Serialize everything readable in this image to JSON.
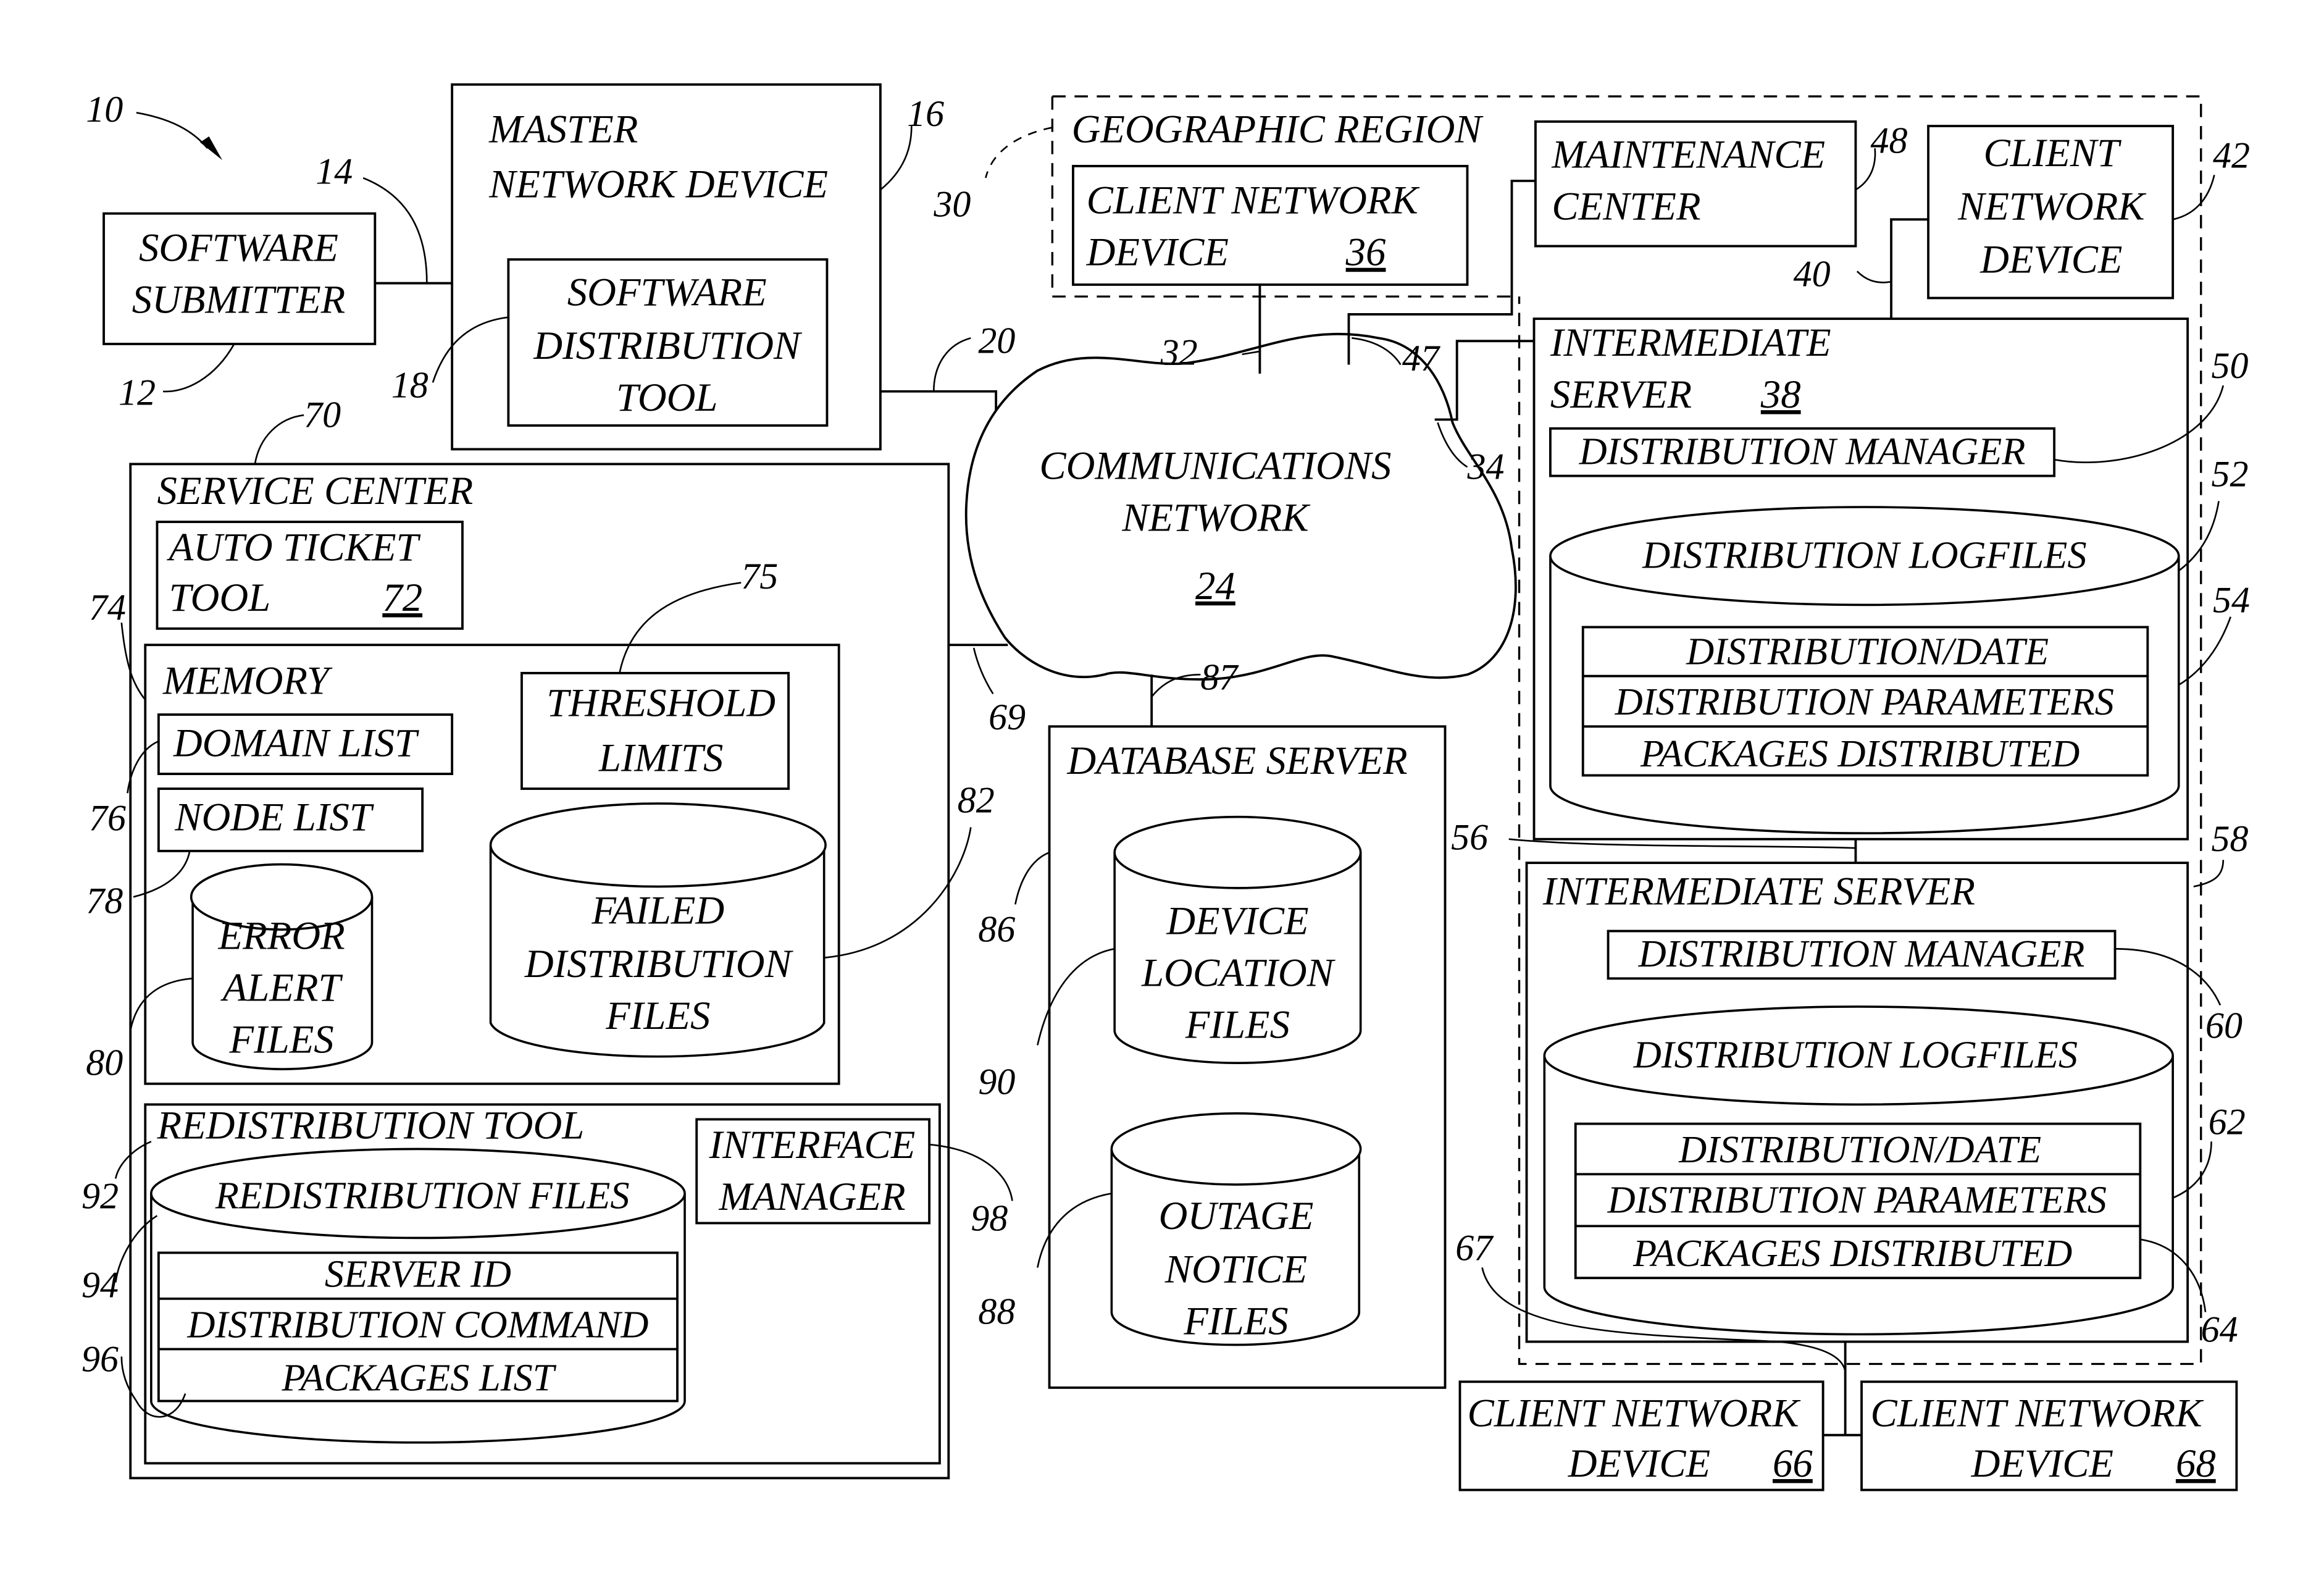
{
  "figure_ref": "10",
  "nodes": {
    "software_submitter": {
      "lines": [
        "SOFTWARE",
        "SUBMITTER"
      ],
      "ref": "12"
    },
    "link_14": {
      "ref": "14"
    },
    "master_network_device": {
      "lines": [
        "MASTER",
        "NETWORK DEVICE"
      ],
      "ref": "16"
    },
    "software_distribution_tool": {
      "lines": [
        "SOFTWARE",
        "DISTRIBUTION",
        "TOOL"
      ],
      "ref": "18"
    },
    "link_20": {
      "ref": "20"
    },
    "communications_network": {
      "lines": [
        "COMMUNICATIONS",
        "NETWORK"
      ],
      "ref": "24"
    },
    "geographic_region": {
      "label": "GEOGRAPHIC REGION",
      "ref": "30"
    },
    "client_device_36": {
      "lines": [
        "CLIENT NETWORK",
        "DEVICE"
      ],
      "ref": "36"
    },
    "link_32": {
      "ref": "32"
    },
    "link_34": {
      "ref": "34"
    },
    "link_47": {
      "ref": "47"
    },
    "maintenance_center": {
      "lines": [
        "MAINTENANCE",
        "CENTER"
      ],
      "ref": "48"
    },
    "client_device_42": {
      "lines": [
        "CLIENT",
        "NETWORK",
        "DEVICE"
      ],
      "ref": "42"
    },
    "link_40": {
      "ref": "40"
    },
    "intermediate_server_38": {
      "lines": [
        "INTERMEDIATE",
        "SERVER"
      ],
      "ref": "38"
    },
    "distribution_manager_50": {
      "label": "DISTRIBUTION MANAGER",
      "ref": "50"
    },
    "distribution_logfiles_52": {
      "label": "DISTRIBUTION LOGFILES",
      "ref": "52",
      "fields": [
        "DISTRIBUTION/DATE",
        "DISTRIBUTION PARAMETERS",
        "PACKAGES DISTRIBUTED"
      ],
      "fields_ref": "54"
    },
    "link_56": {
      "ref": "56"
    },
    "region_58": {
      "ref": "58"
    },
    "intermediate_server_2": {
      "label": "INTERMEDIATE SERVER"
    },
    "distribution_manager_60": {
      "label": "DISTRIBUTION MANAGER",
      "ref": "60"
    },
    "distribution_logfiles_62": {
      "label": "DISTRIBUTION LOGFILES",
      "ref": "62",
      "fields": [
        "DISTRIBUTION/DATE",
        "DISTRIBUTION PARAMETERS",
        "PACKAGES DISTRIBUTED"
      ],
      "fields_ref": "64"
    },
    "link_67": {
      "ref": "67"
    },
    "client_device_66": {
      "lines": [
        "CLIENT NETWORK",
        "DEVICE"
      ],
      "ref": "66"
    },
    "client_device_68": {
      "lines": [
        "CLIENT NETWORK",
        "DEVICE"
      ],
      "ref": "68"
    },
    "service_center": {
      "label": "SERVICE  CENTER",
      "ref": "70"
    },
    "link_69": {
      "ref": "69"
    },
    "auto_ticket_tool": {
      "lines": [
        "AUTO TICKET",
        "TOOL"
      ],
      "ref": "72"
    },
    "memory": {
      "label": "MEMORY",
      "ref": "74"
    },
    "threshold_limits": {
      "lines": [
        "THRESHOLD",
        "LIMITS"
      ],
      "ref": "75"
    },
    "domain_list": {
      "label": "DOMAIN LIST",
      "ref": "76"
    },
    "node_list": {
      "label": "NODE  LIST",
      "ref": "78"
    },
    "error_alert_files": {
      "lines": [
        "ERROR",
        "ALERT",
        "FILES"
      ],
      "ref": "80"
    },
    "failed_distribution_files": {
      "lines": [
        "FAILED",
        "DISTRIBUTION",
        "FILES"
      ],
      "ref": "82"
    },
    "redistribution_tool": {
      "label": "REDISTRIBUTION TOOL",
      "ref": "92"
    },
    "redistribution_files": {
      "label": "REDISTRIBUTION FILES",
      "ref": "94",
      "fields": [
        "SERVER ID",
        "DISTRIBUTION COMMAND",
        "PACKAGES LIST"
      ],
      "fields_ref": "96"
    },
    "interface_manager": {
      "lines": [
        "INTERFACE",
        "MANAGER"
      ],
      "ref": "98"
    },
    "database_server": {
      "label": "DATABASE SERVER",
      "ref": "86"
    },
    "link_87": {
      "ref": "87"
    },
    "device_location_files": {
      "lines": [
        "DEVICE",
        "LOCATION",
        "FILES"
      ],
      "ref": "90"
    },
    "outage_notice_files": {
      "lines": [
        "OUTAGE",
        "NOTICE",
        "FILES"
      ],
      "ref": "88"
    }
  }
}
